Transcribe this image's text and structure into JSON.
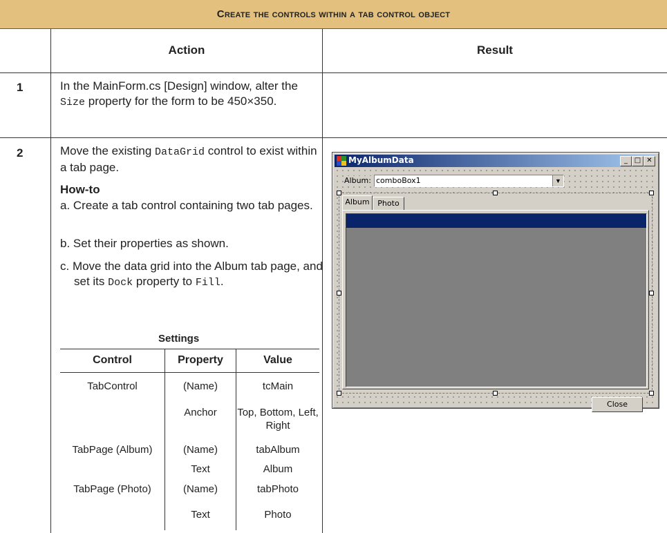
{
  "banner": {
    "title": "Create the controls within a tab control object"
  },
  "headers": {
    "action": "Action",
    "result": "Result"
  },
  "steps": [
    {
      "num": "1",
      "text_pre": "In the MainForm.cs [Design] window, alter the ",
      "code": "Size",
      "text_post": " property for the form to be 450×350."
    },
    {
      "num": "2",
      "text_pre": "Move the existing ",
      "code": "DataGrid",
      "text_post": " control to exist within a tab page.",
      "howto": {
        "title": "How-to",
        "a": "a. Create a tab control containing two tab pages.",
        "b": "b. Set their properties as shown.",
        "c_pre": "c. Move the data grid into the Album tab page, and set its ",
        "c_code1": "Dock",
        "c_mid": " property to ",
        "c_code2": "Fill",
        "c_post": "."
      }
    }
  ],
  "settings": {
    "caption": "Settings",
    "columns": [
      "Control",
      "Property",
      "Value"
    ],
    "rows": [
      [
        "TabControl",
        "(Name)",
        "tcMain"
      ],
      [
        "",
        "Anchor",
        "Top, Bottom, Left, Right"
      ],
      [
        "TabPage (Album)",
        "(Name)",
        "tabAlbum"
      ],
      [
        "",
        "Text",
        "Album"
      ],
      [
        "TabPage (Photo)",
        "(Name)",
        "tabPhoto"
      ],
      [
        "",
        "Text",
        "Photo"
      ]
    ]
  },
  "screenshot": {
    "window_title": "MyAlbumData",
    "album_label": "Album:",
    "combo_value": "comboBox1",
    "tabs": [
      "Album",
      "Photo"
    ],
    "close_button": "Close",
    "title_gradient": [
      "#0a246a",
      "#a6caf0"
    ]
  }
}
